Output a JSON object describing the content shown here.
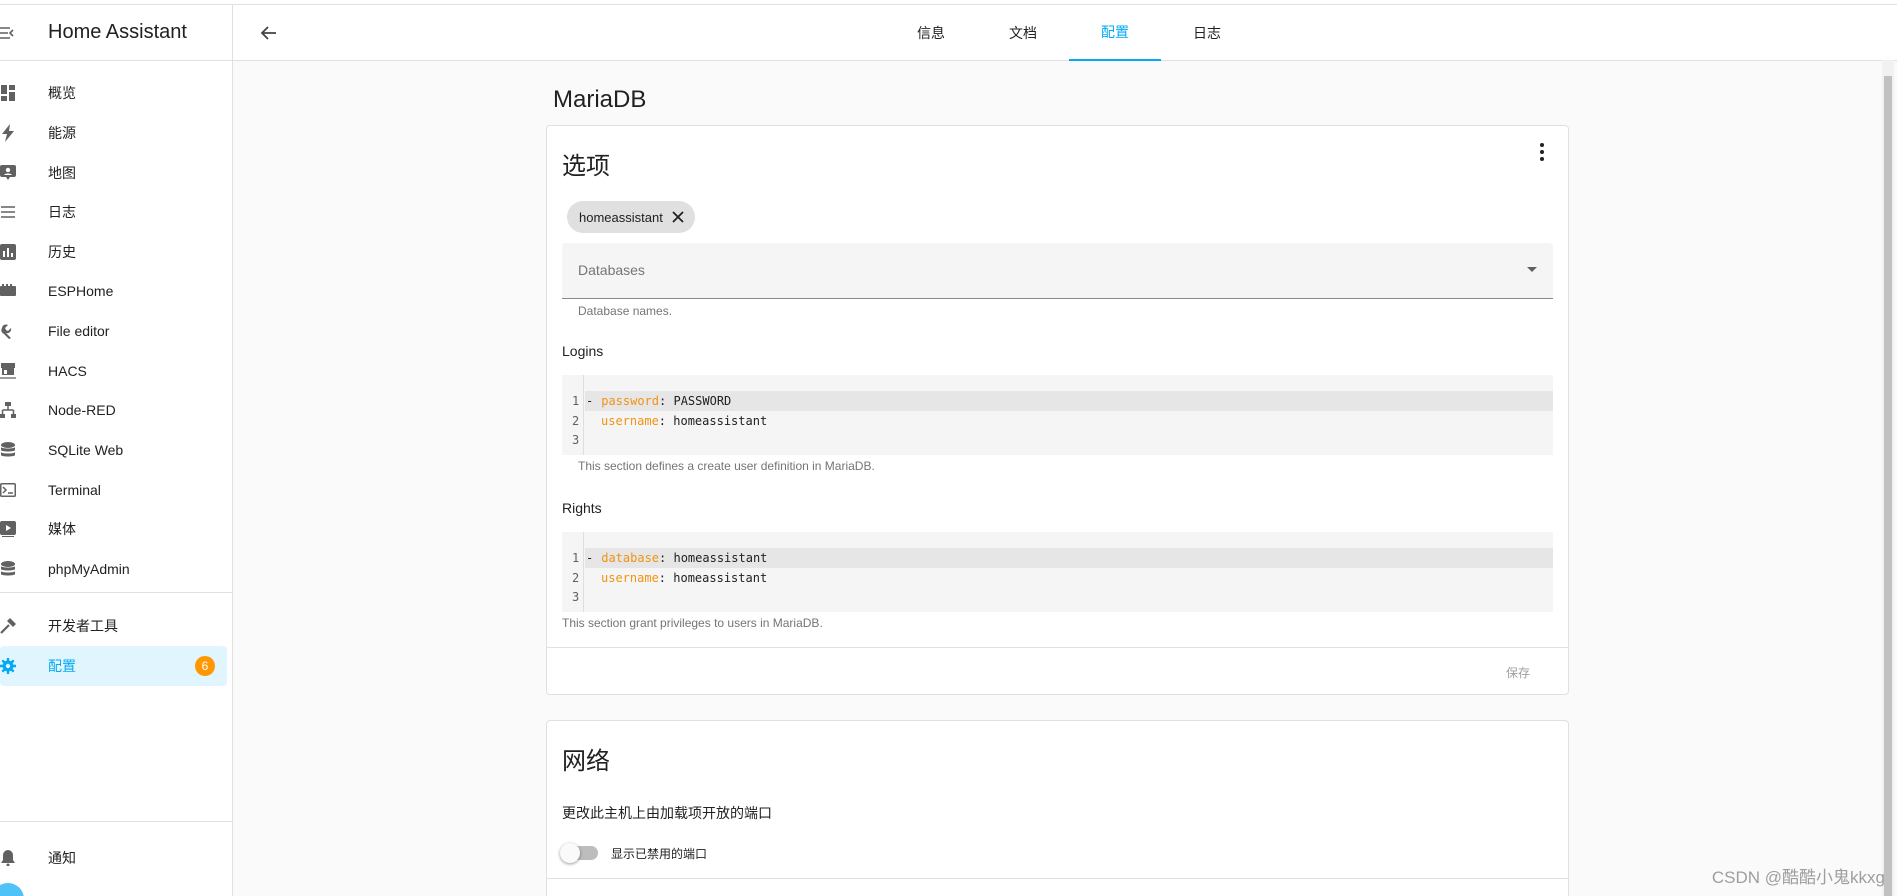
{
  "sidebar": {
    "title": "Home Assistant",
    "items": [
      {
        "label": "概览",
        "icon": "dashboard-icon"
      },
      {
        "label": "能源",
        "icon": "lightning-icon"
      },
      {
        "label": "地图",
        "icon": "map-person-icon"
      },
      {
        "label": "日志",
        "icon": "list-icon"
      },
      {
        "label": "历史",
        "icon": "chart-bar-icon"
      },
      {
        "label": "ESPHome",
        "icon": "chip-icon"
      },
      {
        "label": "File editor",
        "icon": "wrench-icon"
      },
      {
        "label": "HACS",
        "icon": "hacs-icon"
      },
      {
        "label": "Node-RED",
        "icon": "sitemap-icon"
      },
      {
        "label": "SQLite Web",
        "icon": "database-icon"
      },
      {
        "label": "Terminal",
        "icon": "console-icon"
      },
      {
        "label": "媒体",
        "icon": "play-box-icon"
      },
      {
        "label": "phpMyAdmin",
        "icon": "database-icon"
      }
    ],
    "dev_tools": "开发者工具",
    "config": "配置",
    "config_badge": "6",
    "notifications": "通知"
  },
  "topbar": {
    "tabs": [
      "信息",
      "文档",
      "配置",
      "日志"
    ],
    "active_tab": "配置"
  },
  "page": {
    "title": "MariaDB"
  },
  "options_card": {
    "title": "选项",
    "chip": "homeassistant",
    "databases_label": "Databases",
    "databases_helper": "Database names.",
    "logins_label": "Logins",
    "logins_lines": [
      {
        "key": "password",
        "value": "PASSWORD"
      },
      {
        "key": "username",
        "value": "homeassistant"
      }
    ],
    "logins_helper": "This section defines a create user definition in MariaDB.",
    "rights_label": "Rights",
    "rights_lines": [
      {
        "key": "database",
        "value": "homeassistant"
      },
      {
        "key": "username",
        "value": "homeassistant"
      }
    ],
    "rights_helper": "This section grant privileges to users in MariaDB.",
    "line_numbers": [
      "1",
      "2",
      "3"
    ],
    "save": "保存"
  },
  "network_card": {
    "title": "网络",
    "description": "更改此主机上由加载项开放的端口",
    "toggle_label": "显示已禁用的端口"
  },
  "watermark": "CSDN @酷酷小鬼kkxg",
  "colors": {
    "accent": "#03a9f4",
    "badge": "#ff9800",
    "yaml_key": "#f29313"
  }
}
